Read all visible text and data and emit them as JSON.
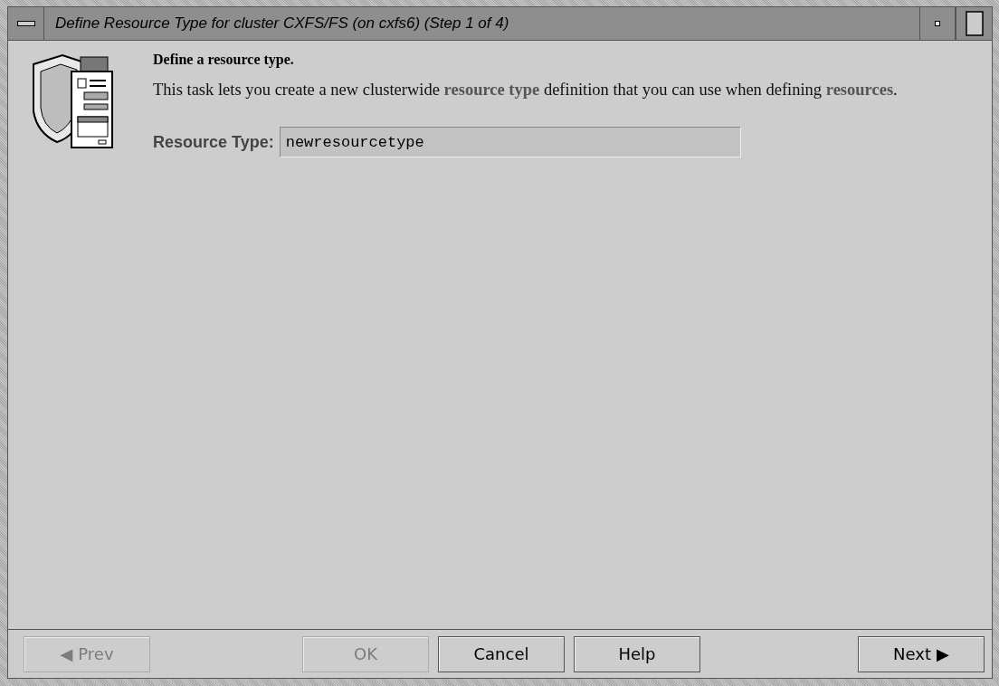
{
  "window": {
    "title": "Define Resource Type for cluster CXFS/FS (on cxfs6) (Step 1 of 4)"
  },
  "heading": "Define a resource type.",
  "description": "This task lets you create a new clusterwide **resource type** definition that you can use when defining **resources**.",
  "field": {
    "label": "Resource Type:",
    "value": "newresourcetype"
  },
  "buttons": [
    {
      "label": "Prev",
      "arrow_left": "◀",
      "disabled": true
    },
    {
      "label": "OK",
      "disabled": true
    },
    {
      "label": "Cancel",
      "disabled": false
    },
    {
      "label": "Help",
      "disabled": false
    },
    {
      "label": "Next",
      "arrow_right": "▶",
      "disabled": false
    }
  ]
}
